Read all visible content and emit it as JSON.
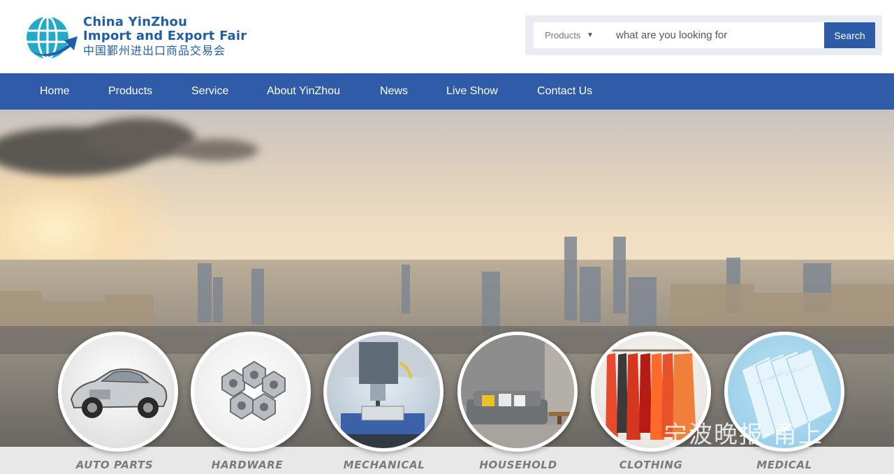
{
  "header": {
    "logo": {
      "line1": "China YinZhou",
      "line2": "Import and Export Fair",
      "line3": "中国鄞州进出口商品交易会",
      "icon": "globe-arrow-icon"
    },
    "search": {
      "category": "Products",
      "placeholder": "what are you looking for",
      "button_label": "Search"
    }
  },
  "nav": {
    "items": [
      {
        "label": "Home"
      },
      {
        "label": "Products"
      },
      {
        "label": "Service"
      },
      {
        "label": "About YinZhou"
      },
      {
        "label": "News"
      },
      {
        "label": "Live Show"
      },
      {
        "label": "Contact Us"
      }
    ]
  },
  "hero": {
    "categories": [
      {
        "label": "AUTO PARTS",
        "icon": "car-icon"
      },
      {
        "label": "HARDWARE",
        "icon": "hex-nuts-icon"
      },
      {
        "label": "MECHANICAL",
        "icon": "cnc-machine-icon"
      },
      {
        "label": "HOUSEHOLD",
        "icon": "sofa-icon"
      },
      {
        "label": "CLOTHING",
        "icon": "clothes-rack-icon"
      },
      {
        "label": "MEDICAL",
        "icon": "face-mask-icon"
      }
    ],
    "watermark": "宁波晚报·甬上"
  },
  "colors": {
    "brand": "#1f5fa8",
    "nav": "#2f5ba9",
    "search_button": "#2e5ba7"
  }
}
